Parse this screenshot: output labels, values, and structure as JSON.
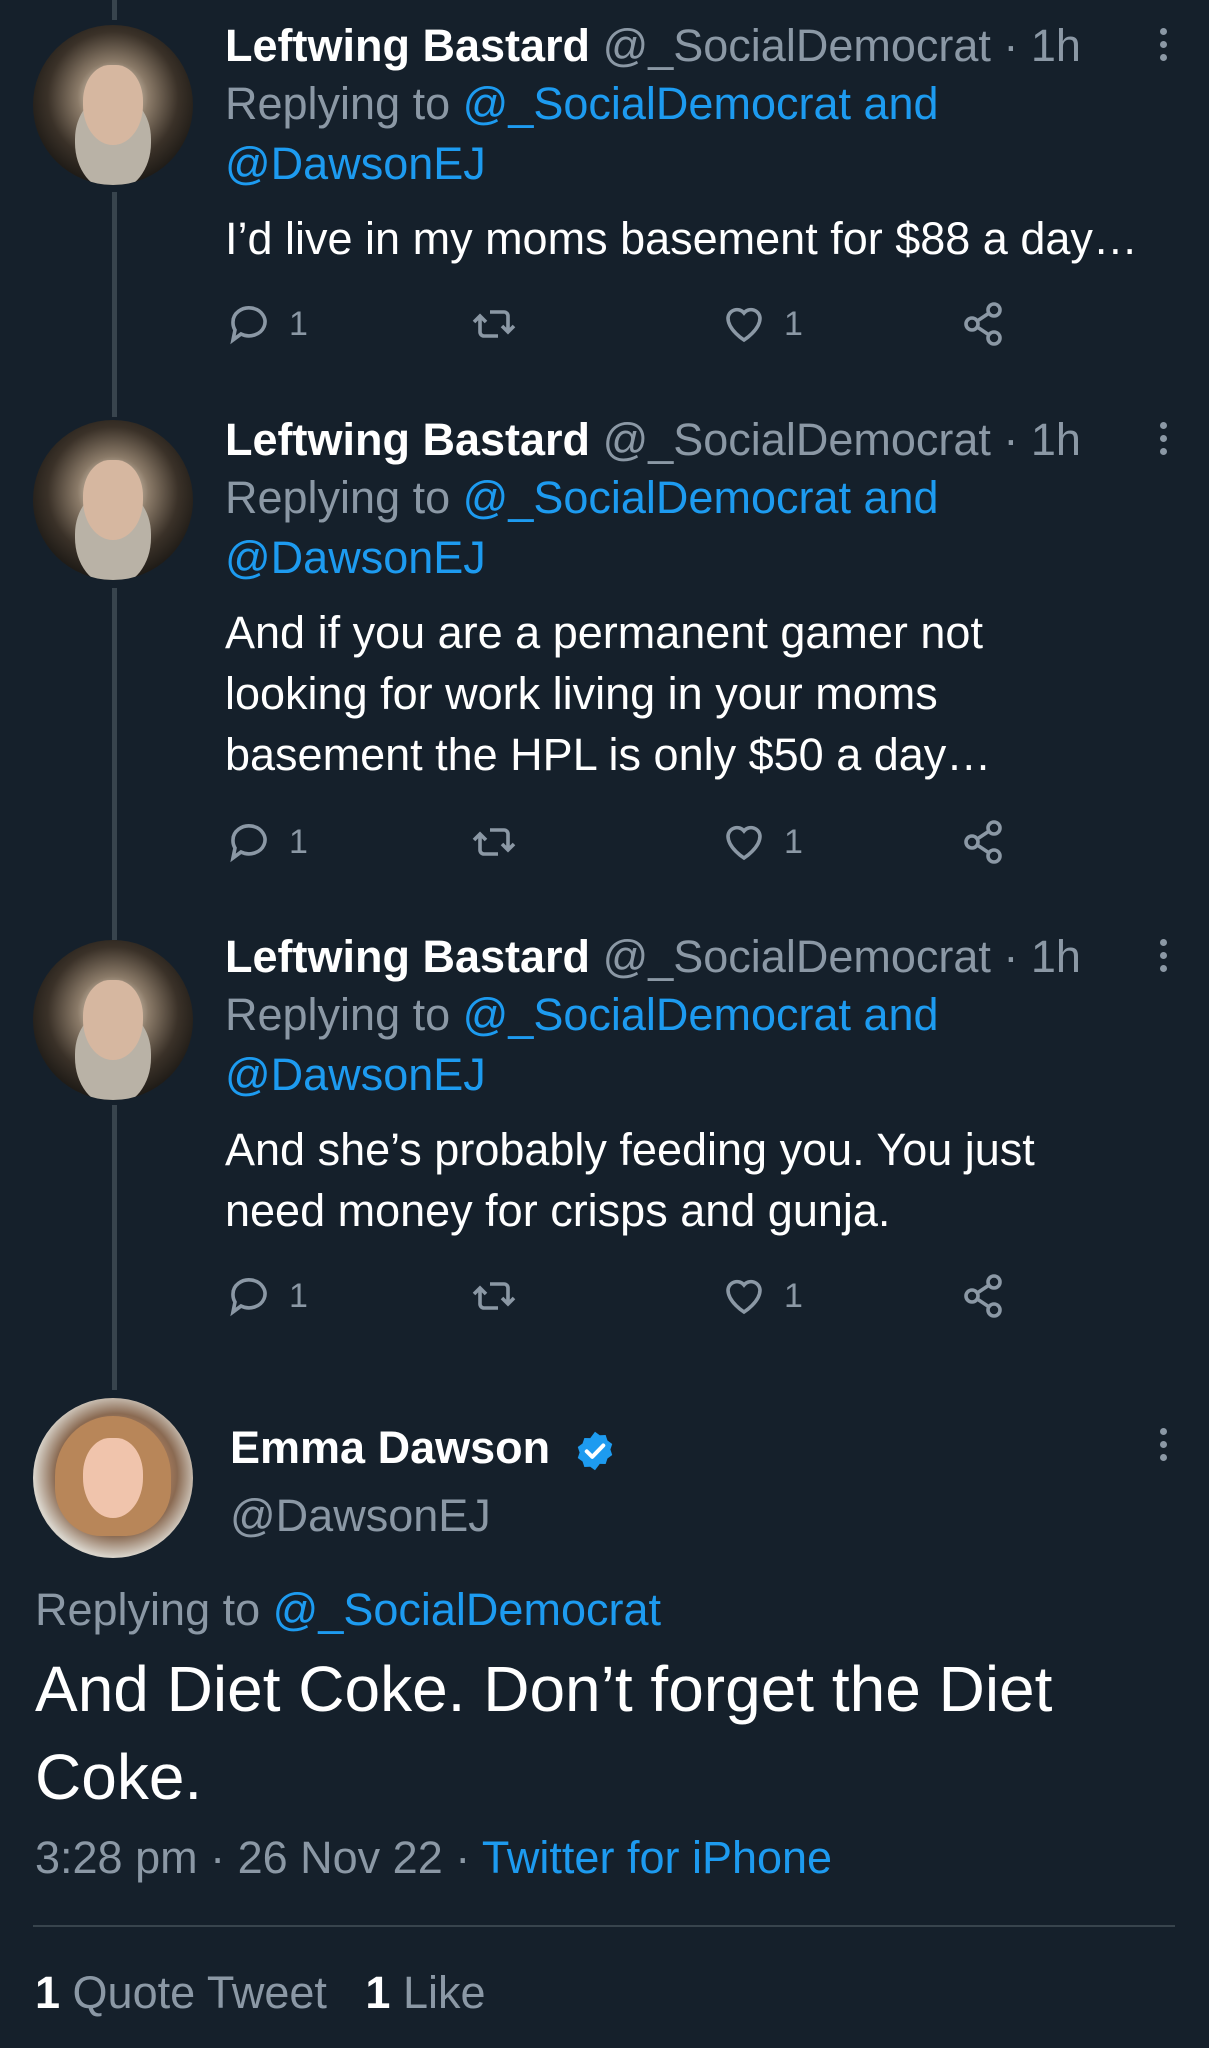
{
  "replies": [
    {
      "name": "Leftwing Bastard",
      "handle": "@_SocialDemocrat",
      "time": "· 1h",
      "replying_prefix": "Replying to",
      "replying_link1": "@_SocialDemocrat and",
      "replying_link2": "@DawsonEJ",
      "text_lines": [
        "I’d live in my moms basement for $88 a day…"
      ],
      "reply_count": "1",
      "like_count": "1"
    },
    {
      "name": "Leftwing Bastard",
      "handle": "@_SocialDemocrat",
      "time": "· 1h",
      "replying_prefix": "Replying to",
      "replying_link1": "@_SocialDemocrat and",
      "replying_link2": "@DawsonEJ",
      "text_lines": [
        "And if you are a permanent gamer not",
        "looking for work living in your moms",
        "basement the HPL is only $50 a day…"
      ],
      "reply_count": "1",
      "like_count": "1"
    },
    {
      "name": "Leftwing Bastard",
      "handle": "@_SocialDemocrat",
      "time": "· 1h",
      "replying_prefix": "Replying to",
      "replying_link1": "@_SocialDemocrat and",
      "replying_link2": "@DawsonEJ",
      "text_lines": [
        "And she’s probably feeding you. You just",
        "need money for crisps and gunja."
      ],
      "reply_count": "1",
      "like_count": "1"
    }
  ],
  "main": {
    "name": "Emma Dawson",
    "handle": "@DawsonEJ",
    "replying_prefix": "Replying to",
    "replying_link": "@_SocialDemocrat",
    "text_line1": "And Diet Coke. Don’t forget the Diet",
    "text_line2": "Coke.",
    "meta_time": "3:28 pm · 26 Nov 22 ·",
    "meta_source": "Twitter for iPhone",
    "quote_count": "1",
    "quote_label": "Quote Tweet",
    "like_count": "1",
    "like_label": "Like"
  },
  "colors": {
    "background": "#15202b",
    "link": "#1d9bf0",
    "muted": "#8b98a5"
  },
  "icons": [
    "reply-icon",
    "retweet-icon",
    "like-icon",
    "share-icon",
    "more-icon",
    "verified-icon"
  ]
}
